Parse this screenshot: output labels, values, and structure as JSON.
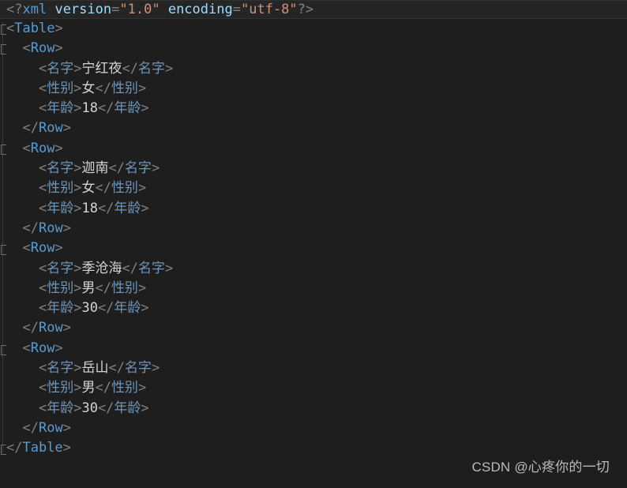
{
  "editor": {
    "theme": "dark",
    "background_color": "#1e1e1e",
    "current_line_background": "#252526",
    "language": "xml",
    "colors": {
      "punctuation": "#808080",
      "tag_name": "#569cd6",
      "tag_name_cjk": "#6f94b8",
      "attribute_name": "#9cdcfe",
      "attribute_value": "#ce9178",
      "text_content": "#d4d4d4",
      "fold_marker": "#6e6e6e",
      "indent_guide": "#3a3a3a",
      "watermark": "#c8c8c8"
    }
  },
  "document": {
    "declaration": {
      "open": "<?",
      "keyword": "xml",
      "attr1_name": "version",
      "attr1_eq": "=",
      "attr1_quote": "\"",
      "attr1_value": "1.0",
      "attr2_name": "encoding",
      "attr2_eq": "=",
      "attr2_quote": "\"",
      "attr2_value": "utf-8",
      "close": "?>"
    },
    "root_open": "<Table>",
    "root_close": "</Table>",
    "row_open": "<Row>",
    "row_close": "</Row>",
    "field_tags": {
      "name_open": "<名字>",
      "name_close": "</名字>",
      "gender_open": "<性别>",
      "gender_close": "</性别>",
      "age_open": "<年龄>",
      "age_close": "</年龄>"
    },
    "rows": [
      {
        "name": "宁红夜",
        "gender": "女",
        "age": "18"
      },
      {
        "name": "迦南",
        "gender": "女",
        "age": "18"
      },
      {
        "name": "季沧海",
        "gender": "男",
        "age": "30"
      },
      {
        "name": "岳山",
        "gender": "男",
        "age": "30"
      }
    ]
  },
  "gutter": {
    "fold_marker_lines": [
      1,
      2,
      8,
      14,
      20,
      26
    ]
  },
  "watermark": {
    "text": "CSDN @心疼你的一切"
  }
}
